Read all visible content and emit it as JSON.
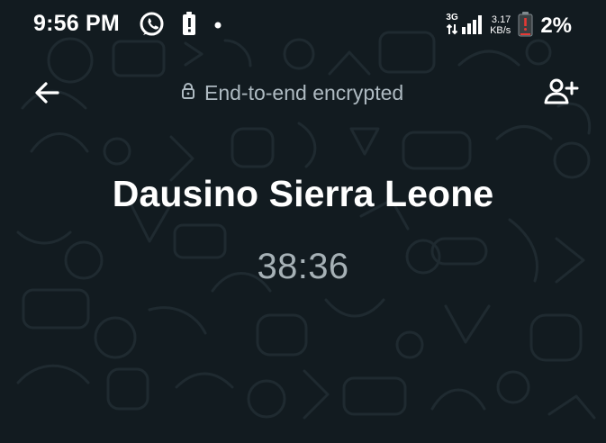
{
  "status_bar": {
    "time": "9:56 PM",
    "network_type": "3G",
    "speed_value": "3.17",
    "speed_unit": "KB/s",
    "battery_percent": "2%",
    "icons": [
      "whatsapp-icon",
      "battery-alert-icon",
      "notification-dot-icon",
      "signal-icon",
      "battery-icon"
    ]
  },
  "header": {
    "encrypted_label": "End-to-end encrypted",
    "icons": [
      "back-arrow-icon",
      "lock-icon",
      "add-person-icon"
    ]
  },
  "call": {
    "contact_name": "Dausino Sierra Leone",
    "duration": "38:36"
  },
  "colors": {
    "background": "#121b20",
    "doodle_stroke": "#1f2a30",
    "muted_text": "#aebac1",
    "timer_text": "#a6b1b6",
    "battery_low": "#e53935"
  }
}
